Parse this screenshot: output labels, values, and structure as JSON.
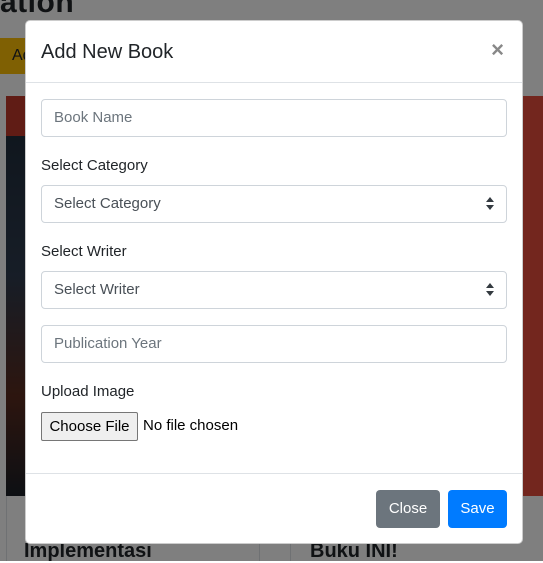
{
  "background": {
    "title_fragment": "ation",
    "add_button_fragment": "Ad",
    "cards": [
      {
        "title": "Implementasi"
      },
      {
        "title": "Buku INI!"
      }
    ]
  },
  "modal": {
    "title": "Add New Book",
    "close_icon": "×",
    "book_name": {
      "placeholder": "Book Name",
      "value": ""
    },
    "category": {
      "label": "Select Category",
      "selected": "Select Category"
    },
    "writer": {
      "label": "Select Writer",
      "selected": "Select Writer"
    },
    "publication_year": {
      "placeholder": "Publication Year",
      "value": ""
    },
    "upload": {
      "label": "Upload Image",
      "button": "Choose File",
      "status": "No file chosen"
    },
    "buttons": {
      "close": "Close",
      "save": "Save"
    }
  },
  "colors": {
    "primary": "#007bff",
    "secondary": "#6c757d",
    "warning": "#ffc107",
    "backdrop": "rgba(0,0,0,0.5)"
  }
}
